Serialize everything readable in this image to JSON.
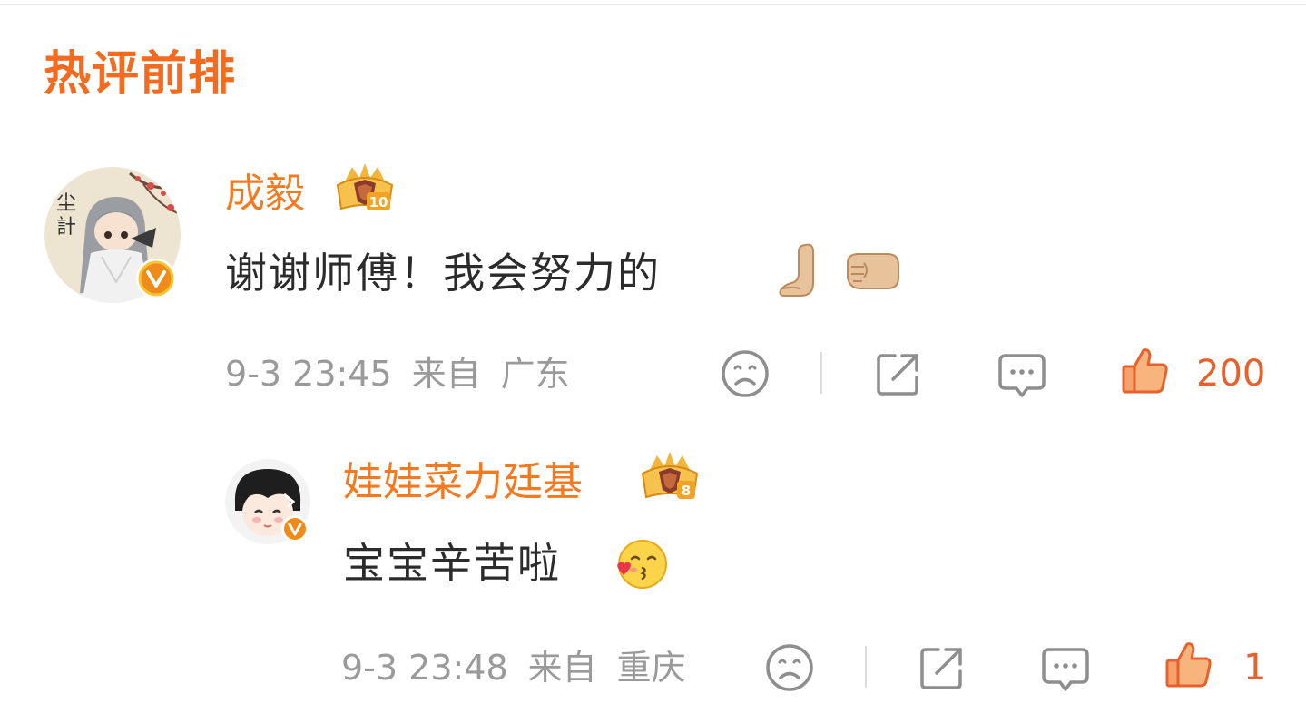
{
  "section": {
    "title": "热评前排"
  },
  "comments": [
    {
      "username": "成毅",
      "text": "谢谢师傅！我会努力的",
      "emojis": [
        "raised-hand-emoji",
        "left-facing-fist-emoji"
      ],
      "time": "9-3 23:45",
      "from_label": "来自",
      "location": "广东",
      "like_count": "200",
      "verified": true,
      "crown_level": "10"
    },
    {
      "username": "娃娃菜力廷基",
      "text": "宝宝辛苦啦",
      "emojis": [
        "kissing-face-emoji"
      ],
      "time": "9-3 23:48",
      "from_label": "来自",
      "location": "重庆",
      "like_count": "1",
      "verified": true,
      "crown_level": "8"
    }
  ],
  "colors": {
    "accent": "#f46a1e",
    "username": "#f47a22",
    "meta": "#9a9a9a",
    "text": "#2b2b2b",
    "like": "#e8612c"
  },
  "icons": {
    "dislike": "sad-face-icon",
    "share": "share-icon",
    "reply": "comment-bubble-icon",
    "like": "thumbs-up-icon"
  }
}
